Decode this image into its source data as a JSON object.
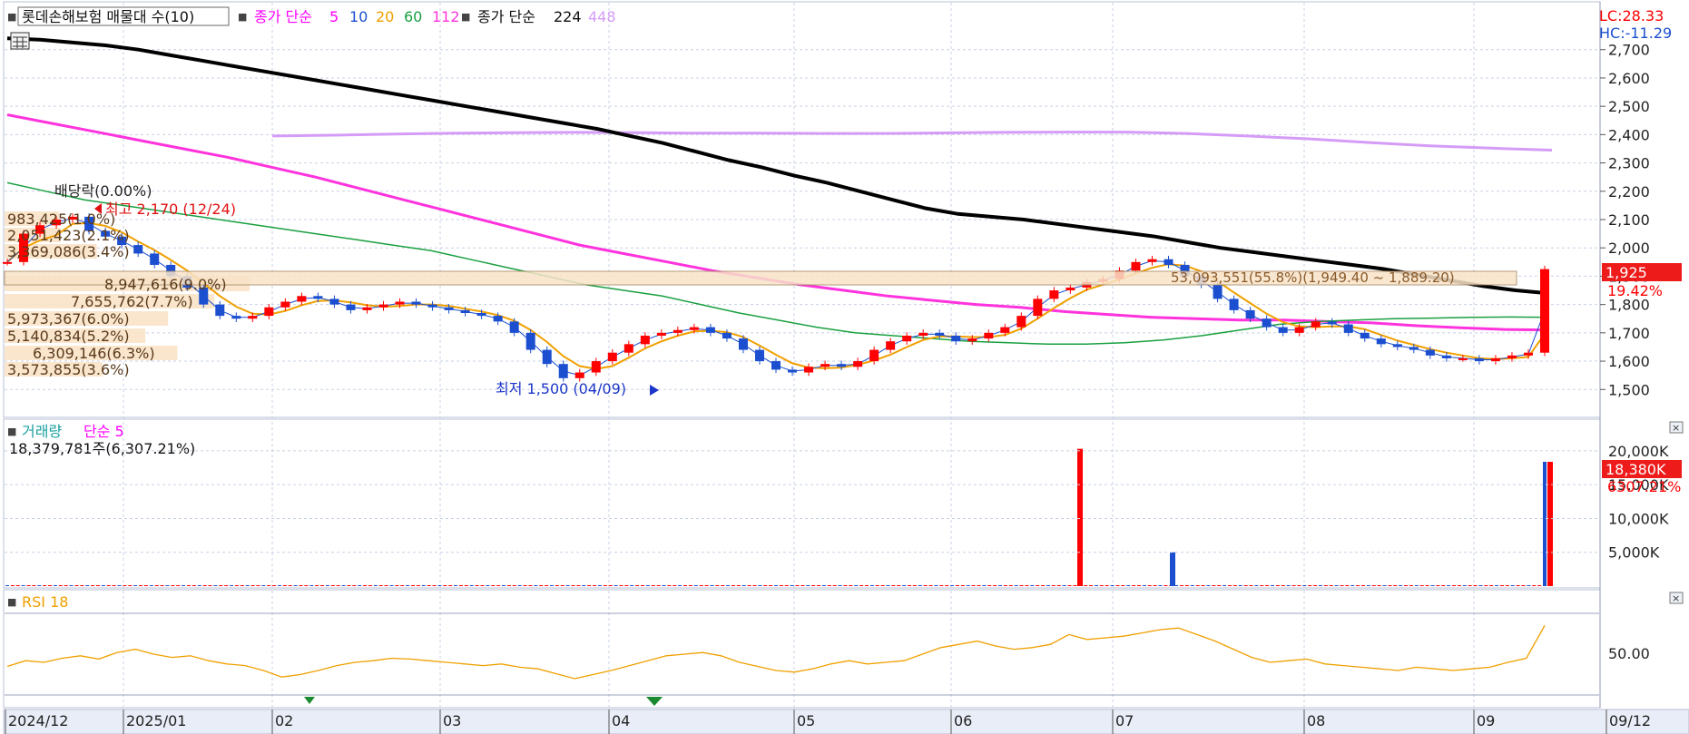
{
  "colors": {
    "up": "#ff0000",
    "down": "#1b4fd0",
    "ma5": "#ff00ff",
    "ma10": "#1b4fd0",
    "ma20": "#f0a000",
    "ma60": "#1aa040",
    "ma112": "#ff33dd",
    "ma224": "#000000",
    "ma448": "#d59cf7",
    "rsi": "#f0a000",
    "grid": "#c8d0e4",
    "axis_bg": "#ffffff"
  },
  "legend": {
    "icon": "■",
    "title": "롯데손해보험 매물대 수(10)",
    "ma_label": "종가 단순",
    "ma_periods": [
      "5",
      "10",
      "20",
      "60",
      "112"
    ],
    "ma_label2": "종가 단순",
    "ma_long": [
      "224",
      "448"
    ]
  },
  "corner": {
    "lc": "LC:28.33",
    "hc": "HC:-11.29"
  },
  "price_axis": {
    "ticks": [
      "2,700",
      "2,600",
      "2,500",
      "2,400",
      "2,300",
      "2,200",
      "2,100",
      "2,000",
      "1,900",
      "1,800",
      "1,700",
      "1,600",
      "1,500"
    ]
  },
  "current_price": {
    "value": "1,925",
    "change": "19.42%"
  },
  "annotations": {
    "dividend": "배당락(0.00%)",
    "high": "최고 2,170 (12/24)",
    "low": "최저 1,500 (04/09)",
    "highlight_band": "53,093,551(55.8%)(1,949.40 ~ 1,889.20)"
  },
  "volume_profile": [
    "983,425(1.0%)",
    "2,051,423(2.1%)",
    "3,369,086(3.4%)",
    "8,947,616(9.0%)",
    "7,655,762(7.7%)",
    "5,973,367(6.0%)",
    "5,140,834(5.2%)",
    "6,309,146(6.3%)",
    "3,573,855(3.6%)"
  ],
  "volume_panel": {
    "icon": "■",
    "title": "거래량",
    "ma": "단순 5",
    "info": "18,379,781주(6,307.21%)",
    "ticks": [
      "20,000K",
      "15,000K",
      "10,000K",
      "5,000K"
    ],
    "current": "18,380K",
    "current_pct": "6307.21%"
  },
  "rsi_panel": {
    "icon": "■",
    "title": "RSI 18",
    "ticks": [
      "50.00"
    ]
  },
  "x_axis": {
    "labels": [
      "2024/12",
      "2025/01",
      "02",
      "03",
      "04",
      "05",
      "06",
      "07",
      "08",
      "09",
      "09/12"
    ]
  },
  "chart_data": {
    "type": "candlestick",
    "title": "롯데손해보험",
    "y_range": [
      1440,
      2760
    ],
    "x_labels": [
      "2024/12",
      "2025/01",
      "02",
      "03",
      "04",
      "05",
      "06",
      "07",
      "08",
      "09"
    ],
    "price_series": [
      1950,
      2050,
      2080,
      2100,
      2110,
      2060,
      2040,
      2010,
      1980,
      1940,
      1900,
      1860,
      1800,
      1760,
      1750,
      1760,
      1790,
      1810,
      1830,
      1820,
      1800,
      1780,
      1790,
      1800,
      1810,
      1800,
      1790,
      1780,
      1770,
      1760,
      1740,
      1700,
      1640,
      1590,
      1540,
      1560,
      1600,
      1630,
      1660,
      1690,
      1700,
      1710,
      1720,
      1700,
      1680,
      1640,
      1600,
      1570,
      1560,
      1580,
      1590,
      1580,
      1600,
      1640,
      1670,
      1690,
      1700,
      1690,
      1670,
      1680,
      1700,
      1720,
      1760,
      1820,
      1850,
      1860,
      1880,
      1890,
      1920,
      1950,
      1960,
      1940,
      1900,
      1870,
      1820,
      1780,
      1750,
      1720,
      1700,
      1720,
      1740,
      1730,
      1700,
      1680,
      1660,
      1650,
      1640,
      1620,
      1610,
      1610,
      1600,
      1610,
      1620,
      1630,
      1925
    ],
    "ma224": [
      2740,
      2735,
      2725,
      2715,
      2700,
      2680,
      2660,
      2640,
      2620,
      2600,
      2580,
      2560,
      2540,
      2520,
      2500,
      2480,
      2460,
      2440,
      2420,
      2395,
      2370,
      2340,
      2310,
      2285,
      2255,
      2230,
      2200,
      2170,
      2140,
      2120,
      2110,
      2100,
      2085,
      2070,
      2055,
      2040,
      2020,
      2000,
      1985,
      1970,
      1955,
      1940,
      1925,
      1905,
      1885,
      1865,
      1850,
      1840
    ],
    "ma448": [
      2395,
      2398,
      2402,
      2405,
      2407,
      2408,
      2407,
      2405,
      2405,
      2404,
      2404,
      2406,
      2408,
      2409,
      2409,
      2404,
      2395,
      2385,
      2372,
      2360,
      2352,
      2345
    ],
    "ma112": [
      2470,
      2440,
      2410,
      2380,
      2350,
      2320,
      2285,
      2250,
      2210,
      2170,
      2130,
      2090,
      2050,
      2010,
      1980,
      1950,
      1920,
      1895,
      1870,
      1850,
      1830,
      1815,
      1800,
      1790,
      1775,
      1765,
      1755,
      1750,
      1745,
      1745,
      1740,
      1735,
      1725,
      1718,
      1712,
      1710
    ],
    "ma60": [
      2230,
      2200,
      2170,
      2150,
      2130,
      2110,
      2090,
      2070,
      2050,
      2030,
      2010,
      1990,
      1960,
      1930,
      1900,
      1870,
      1850,
      1830,
      1800,
      1770,
      1745,
      1720,
      1700,
      1690,
      1680,
      1670,
      1665,
      1660,
      1660,
      1665,
      1675,
      1690,
      1710,
      1730,
      1740,
      1745,
      1750,
      1752,
      1755,
      1756,
      1755
    ],
    "volume": [
      3,
      3,
      3,
      3,
      3,
      3,
      3,
      3,
      3,
      3,
      3,
      3,
      5,
      3,
      3,
      3,
      3,
      3,
      3,
      3,
      3,
      3,
      3,
      3,
      3,
      3,
      3,
      3,
      3,
      3,
      3,
      3,
      3,
      3,
      3,
      5,
      3,
      3,
      3,
      3,
      3,
      3,
      3,
      3,
      3,
      3,
      3,
      3,
      3,
      3,
      3,
      3,
      3,
      3,
      3,
      3,
      3,
      3,
      3,
      3,
      3,
      3,
      3,
      3,
      3,
      3,
      3,
      3,
      3,
      3,
      3,
      3,
      3,
      3,
      3,
      3,
      3,
      3,
      3,
      3,
      3,
      3,
      3,
      3,
      3,
      3,
      3,
      3,
      3,
      3,
      3,
      3,
      3,
      3,
      3,
      3,
      3,
      3,
      3,
      3,
      3,
      3,
      3,
      3,
      3,
      3,
      3,
      3,
      3,
      3,
      3,
      3,
      3,
      3,
      3,
      3,
      3,
      3,
      3,
      3,
      3,
      3,
      3,
      3,
      3,
      3,
      3,
      3,
      3,
      3,
      3,
      3,
      3,
      3,
      3,
      3,
      3,
      3,
      3,
      3,
      3,
      3,
      3,
      3,
      3,
      3,
      3,
      3,
      3,
      3,
      3,
      3,
      3,
      3,
      3,
      3,
      3,
      3,
      3,
      3,
      3,
      3,
      3,
      3,
      3,
      3,
      3,
      3,
      3,
      3,
      3,
      3,
      3,
      3,
      3,
      3,
      3,
      3,
      3,
      3,
      3,
      3,
      3,
      3,
      3,
      3,
      3,
      3,
      3,
      3,
      3,
      3,
      3,
      3,
      3,
      3,
      3,
      3,
      3,
      3,
      3,
      3,
      3,
      3,
      3,
      3,
      3,
      3,
      3,
      3,
      3,
      3,
      3,
      3,
      3,
      3,
      3,
      3,
      3,
      3,
      3,
      3,
      3,
      3,
      3,
      3,
      3,
      3,
      3,
      3,
      3,
      3,
      3,
      3,
      3,
      3,
      3,
      3,
      3,
      3,
      3,
      3,
      3,
      3,
      3,
      3,
      3,
      3,
      3,
      3,
      3,
      3,
      3,
      3,
      3,
      3,
      3,
      3,
      3,
      3,
      3,
      3,
      3,
      3,
      3,
      3,
      3,
      3,
      3,
      3,
      3,
      3,
      3,
      3,
      3,
      3,
      3,
      3,
      3,
      3,
      3,
      3,
      3,
      3,
      3,
      3,
      3,
      3,
      18380
    ],
    "rsi": [
      35,
      42,
      40,
      45,
      48,
      44,
      52,
      56,
      50,
      46,
      48,
      42,
      38,
      36,
      30,
      22,
      25,
      30,
      36,
      40,
      42,
      45,
      44,
      42,
      40,
      38,
      36,
      38,
      34,
      32,
      26,
      20,
      25,
      30,
      36,
      42,
      48,
      50,
      52,
      48,
      40,
      35,
      30,
      28,
      32,
      38,
      42,
      38,
      40,
      42,
      50,
      58,
      62,
      66,
      60,
      56,
      58,
      62,
      74,
      68,
      70,
      72,
      76,
      80,
      82,
      74,
      66,
      56,
      46,
      40,
      42,
      44,
      38,
      36,
      34,
      32,
      30,
      34,
      32,
      30,
      32,
      34,
      40,
      45,
      85
    ]
  }
}
